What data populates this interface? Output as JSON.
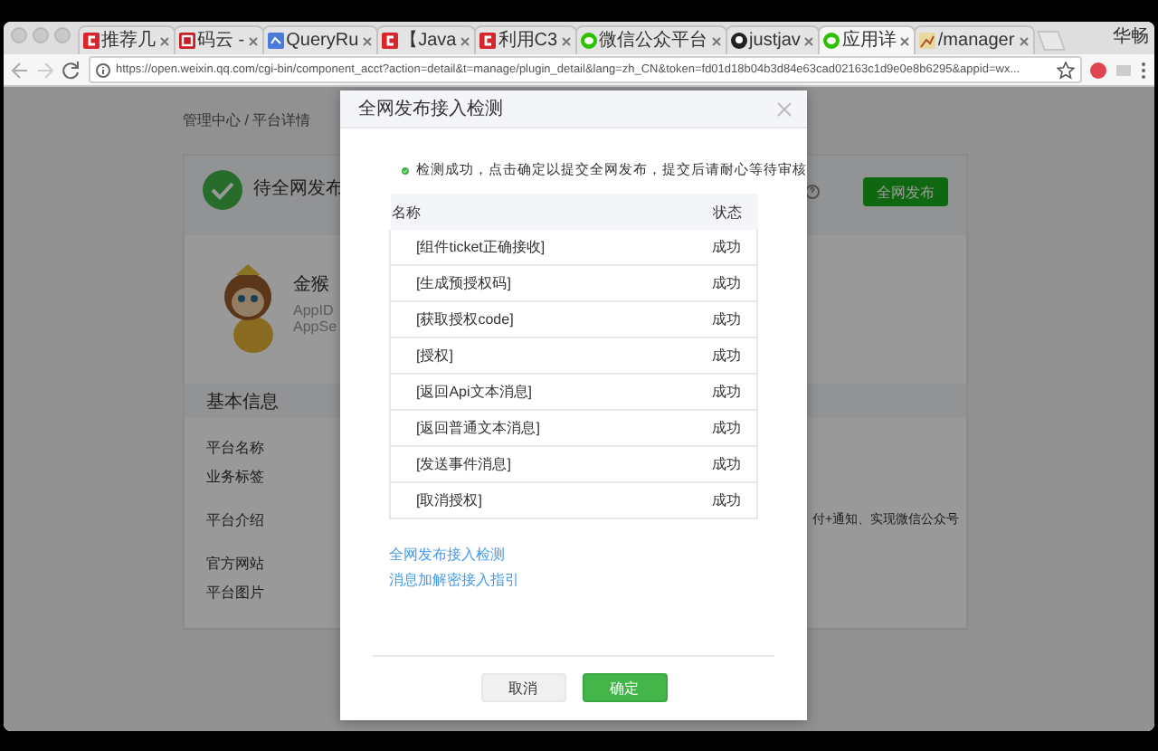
{
  "browser": {
    "tabs": [
      {
        "title": "推荐几",
        "kind": "csdn",
        "selected": false
      },
      {
        "title": "码云 -",
        "kind": "gitee",
        "selected": false
      },
      {
        "title": "QueryRu",
        "kind": "doc",
        "selected": false
      },
      {
        "title": "【Java",
        "kind": "csdn",
        "selected": false
      },
      {
        "title": "利用C3",
        "kind": "csdn",
        "selected": false
      },
      {
        "title": "微信公众平台",
        "kind": "wechat",
        "selected": false
      },
      {
        "title": "justjav",
        "kind": "github",
        "selected": false
      },
      {
        "title": "应用详",
        "kind": "wechat",
        "selected": true
      },
      {
        "title": "/manager",
        "kind": "chart",
        "selected": false
      }
    ],
    "user": "华畅",
    "url": "https://open.weixin.qq.com/cgi-bin/component_acct?action=detail&t=manage/plugin_detail&lang=zh_CN&token=fd01d18b04b3d84e63cad02163c1d9e0e8b6295&appid=wx..."
  },
  "page": {
    "breadcrumb": "管理中心 / 平台详情",
    "status": {
      "title": "待全网发布",
      "button": "全网发布"
    },
    "profile": {
      "name": "金猴",
      "lines": [
        "AppID",
        "AppSe"
      ]
    },
    "section_title": "基本信息",
    "fields": [
      {
        "label": "平台名称"
      },
      {
        "label": "业务标签"
      },
      {
        "label": "平台介绍",
        "value": "付+通知、实现微信公众号"
      },
      {
        "label": "官方网站"
      },
      {
        "label": "平台图片"
      }
    ]
  },
  "dialog": {
    "title": "全网发布接入检测",
    "message": "检测成功，点击确定以提交全网发布，提交后请耐心等待审核",
    "table": {
      "columns": [
        "名称",
        "状态"
      ],
      "rows": [
        {
          "name": "[组件ticket正确接收]",
          "status": "成功"
        },
        {
          "name": "[生成预授权码]",
          "status": "成功"
        },
        {
          "name": "[获取授权code]",
          "status": "成功"
        },
        {
          "name": "[授权]",
          "status": "成功"
        },
        {
          "name": "[返回Api文本消息]",
          "status": "成功"
        },
        {
          "name": "[返回普通文本消息]",
          "status": "成功"
        },
        {
          "name": "[发送事件消息]",
          "status": "成功"
        },
        {
          "name": "[取消授权]",
          "status": "成功"
        }
      ]
    },
    "links": [
      "全网发布接入检测",
      "消息加解密接入指引"
    ],
    "buttons": [
      {
        "label": "取消",
        "kind": "secondary"
      },
      {
        "label": "确定",
        "kind": "primary"
      }
    ]
  }
}
